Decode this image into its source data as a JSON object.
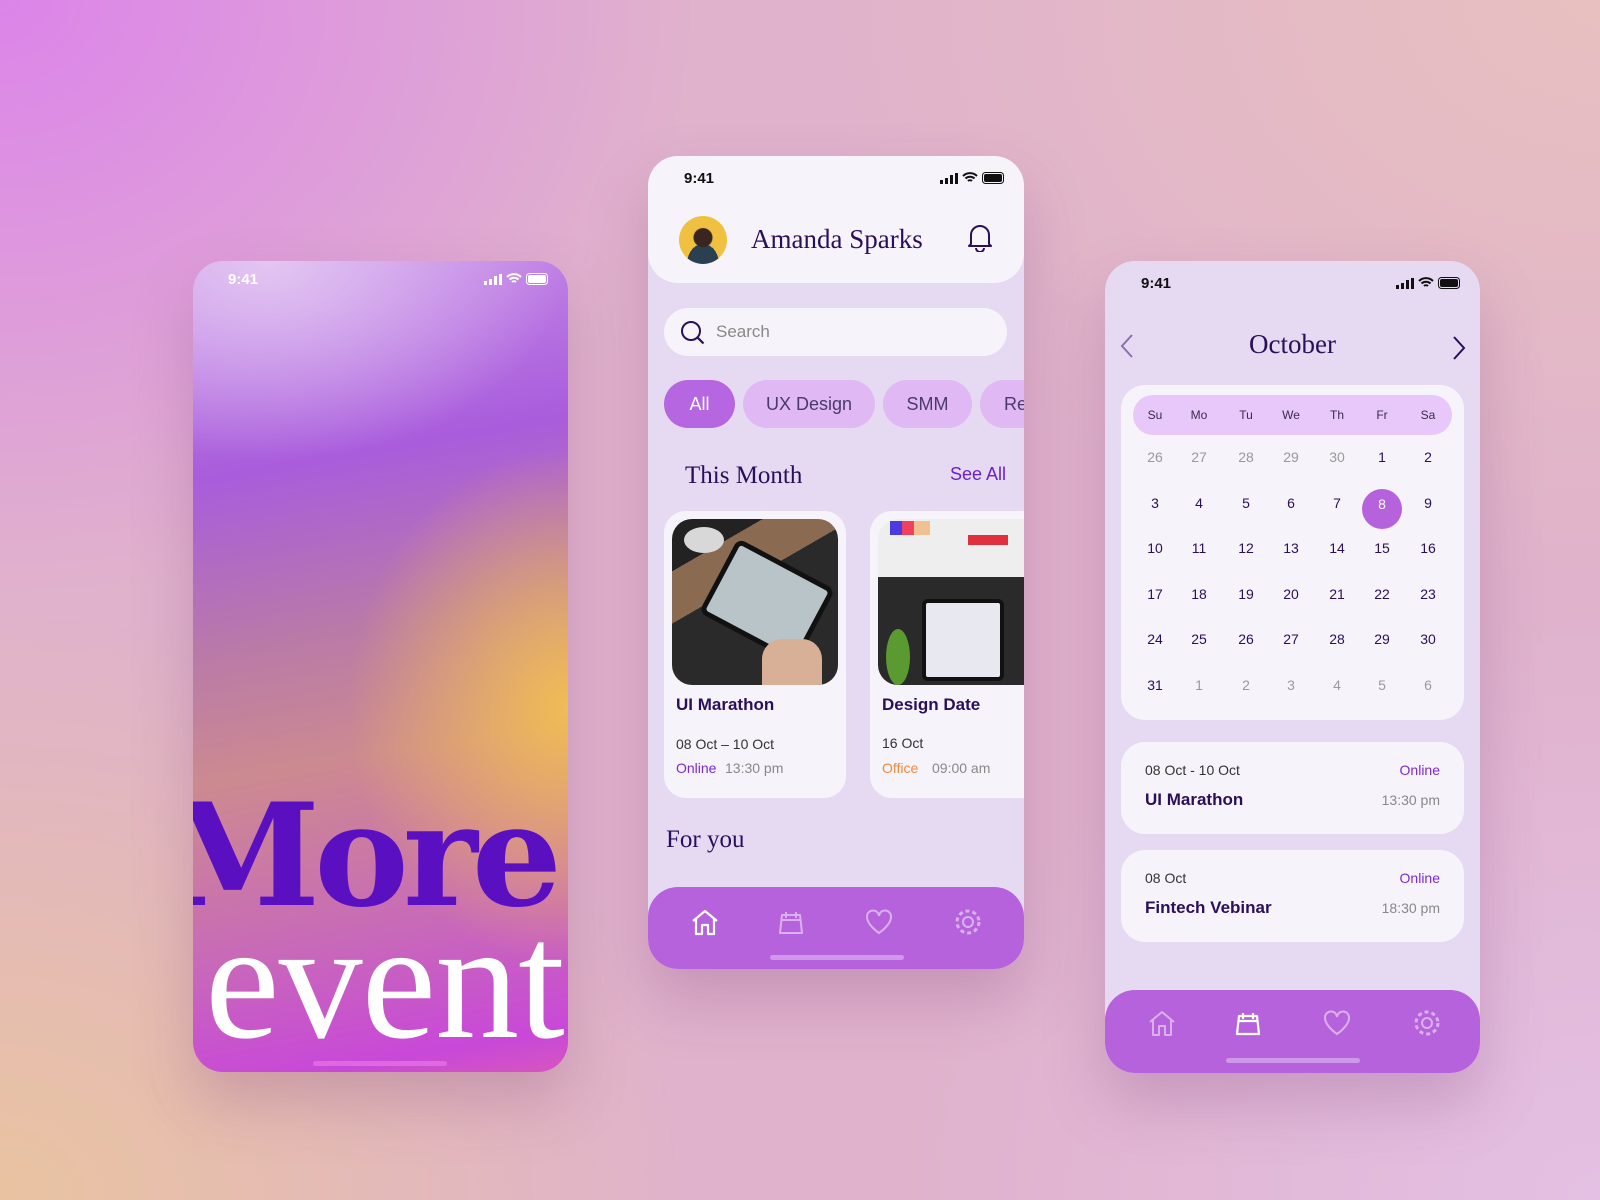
{
  "status_time": "9:41",
  "splash": {
    "line1": "More",
    "line2": "events"
  },
  "home": {
    "user_name": "Amanda Sparks",
    "search_placeholder": "Search",
    "chips": [
      "All",
      "UX Design",
      "SMM",
      "Re"
    ],
    "section_title": "This Month",
    "see_all": "See All",
    "events": [
      {
        "title": "UI Marathon",
        "date": "08 Oct – 10 Oct",
        "mode": "Online",
        "mode_color": "#7a2ad8",
        "time": "13:30 pm"
      },
      {
        "title": "Design Date",
        "date": "16 Oct",
        "mode": "Office",
        "mode_color": "#f08a3a",
        "time": "09:00 am"
      }
    ],
    "for_you": "For you",
    "active_tab": "home"
  },
  "calendar": {
    "month": "October",
    "weekdays": [
      "Su",
      "Mo",
      "Tu",
      "We",
      "Th",
      "Fr",
      "Sa"
    ],
    "weeks": [
      [
        "26",
        "27",
        "28",
        "29",
        "30",
        "1",
        "2"
      ],
      [
        "3",
        "4",
        "5",
        "6",
        "7",
        "8",
        "9"
      ],
      [
        "10",
        "11",
        "12",
        "13",
        "14",
        "15",
        "16"
      ],
      [
        "17",
        "18",
        "19",
        "20",
        "21",
        "22",
        "23"
      ],
      [
        "24",
        "25",
        "26",
        "27",
        "28",
        "29",
        "30"
      ],
      [
        "31",
        "1",
        "2",
        "3",
        "4",
        "5",
        "6"
      ]
    ],
    "selected_day": "8",
    "events": [
      {
        "date": "08 Oct - 10 Oct",
        "mode": "Online",
        "title": "UI Marathon",
        "time": "13:30 pm"
      },
      {
        "date": "08 Oct",
        "mode": "Online",
        "title": "Fintech Vebinar",
        "time": "18:30 pm"
      }
    ],
    "active_tab": "calendar"
  },
  "colors": {
    "accent": "#b562dc",
    "dark_text": "#2a0f5a",
    "online": "#7a2ad8",
    "office": "#f08a3a"
  },
  "nav_icons": [
    "home-icon",
    "calendar-icon",
    "heart-icon",
    "gear-icon"
  ]
}
